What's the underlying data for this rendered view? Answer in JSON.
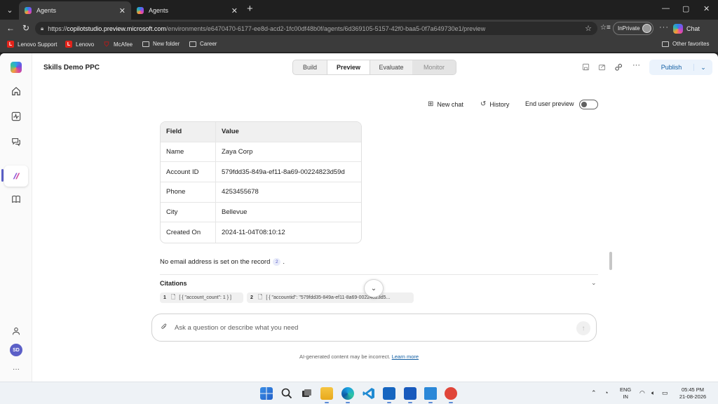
{
  "browser": {
    "tabs": [
      {
        "title": "Agents",
        "close": "✕"
      },
      {
        "title": "Agents",
        "close": "✕"
      }
    ],
    "new_tab": "+",
    "window_controls": {
      "minimize": "—",
      "maximize": "▢",
      "close": "✕"
    },
    "url": {
      "scheme": "https://",
      "host": "copilotstudio.preview.microsoft.com",
      "path": "/environments/e6470470-6177-ee8d-acd2-1fc00df48b0f/agents/6d369105-5157-42f0-baa5-0f7a649730e1/preview"
    },
    "inprivate_label": "InPrivate",
    "more": "···",
    "copilot_label": "Chat",
    "favorites": [
      {
        "label": "Lenovo Support",
        "icon": "lenovo-icon"
      },
      {
        "label": "Lenovo",
        "icon": "lenovo-icon"
      },
      {
        "label": "McAfee",
        "icon": "mcafee-icon"
      },
      {
        "label": "New folder",
        "icon": "folder-icon"
      },
      {
        "label": "Career",
        "icon": "folder-icon"
      }
    ],
    "other_favorites": "Other favorites"
  },
  "app": {
    "agent_name": "Skills Demo PPC",
    "modes": {
      "build": "Build",
      "preview": "Preview",
      "evaluate": "Evaluate",
      "monitor": "Monitor"
    },
    "publish": "Publish",
    "more": "···",
    "chat_header": {
      "new_chat": "New chat",
      "history": "History",
      "end_user_preview": "End user preview"
    },
    "user_initials": "SD",
    "rail_more": "···"
  },
  "record_table": {
    "headers": [
      "Field",
      "Value"
    ],
    "rows": [
      {
        "field": "Name",
        "value": "Zaya Corp"
      },
      {
        "field": "Account ID",
        "value": "579fdd35-849a-ef11-8a69-00224823d59d"
      },
      {
        "field": "Phone",
        "value": "4253455678"
      },
      {
        "field": "City",
        "value": "Bellevue"
      },
      {
        "field": "Created On",
        "value": "2024-11-04T08:10:12"
      }
    ]
  },
  "message": {
    "text": "No email address is set on the record",
    "citation_ref": "2",
    "tail": "."
  },
  "citations": {
    "title": "Citations",
    "items": [
      {
        "num": "1",
        "text": "[ { \"account_count\": 1 } ]"
      },
      {
        "num": "2",
        "text": "[ { \"accountid\": \"579fdd35-849a-ef11-8a69-00224823d5..."
      }
    ]
  },
  "composer": {
    "placeholder": "Ask a question or describe what you need"
  },
  "disclaimer": {
    "text": "AI-generated content may be incorrect.",
    "link": "Learn more"
  },
  "taskbar": {
    "language": "ENG",
    "region": "IN",
    "time": "05:45 PM",
    "date": "21-08-2026"
  }
}
